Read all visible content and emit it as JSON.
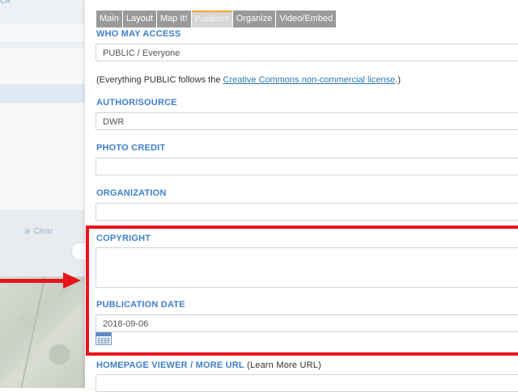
{
  "background": {
    "top_label": "CR",
    "clear_label": "Clear",
    "clear_icon": "x-icon"
  },
  "tabs": [
    {
      "label": "Main"
    },
    {
      "label": "Layout"
    },
    {
      "label": "Map It!"
    },
    {
      "label": "Publish?",
      "active": true
    },
    {
      "label": "Organize"
    },
    {
      "label": "Video/Embed"
    }
  ],
  "access": {
    "label": "WHO MAY ACCESS",
    "value": "PUBLIC / Everyone"
  },
  "license": {
    "prefix": "(Everything PUBLIC follows the ",
    "link": "Creative Commons non-commercial license",
    "suffix": ".)"
  },
  "author": {
    "label": "AUTHOR/SOURCE",
    "value": "DWR"
  },
  "photo_credit": {
    "label": "PHOTO CREDIT",
    "value": ""
  },
  "organization": {
    "label": "ORGANIZATION",
    "value": ""
  },
  "copyright": {
    "label": "COPYRIGHT",
    "value": ""
  },
  "publication_date": {
    "label": "PUBLICATION DATE",
    "value": "2018-09-06"
  },
  "homepage": {
    "label": "HOMEPAGE VIEWER / MORE URL",
    "note": " (Learn More URL)",
    "value": ""
  },
  "colors": {
    "accent_label": "#3d7fcc",
    "annotation_red": "#e8131b",
    "active_tab_marker": "#f0a830"
  }
}
